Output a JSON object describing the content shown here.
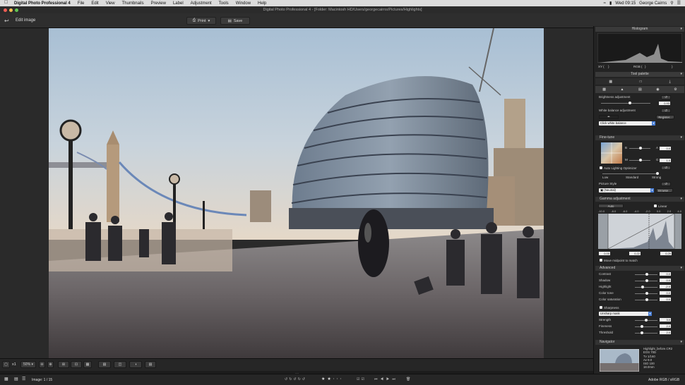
{
  "menubar": {
    "apple": "",
    "app": "Digital Photo Professional 4",
    "items": [
      "File",
      "Edit",
      "View",
      "Thumbnails",
      "Preview",
      "Label",
      "Adjustment",
      "Tools",
      "Window",
      "Help"
    ],
    "clock": "Wed 09:15",
    "user": "George Cairns"
  },
  "window": {
    "title": "Digital Photo Professional 4 - [Folder: Macintosh HD/Users/georgecairns/Pictures/Highlights]"
  },
  "toolbar": {
    "back_label": "Edit image",
    "print_label": "Print",
    "save_label": "Save"
  },
  "viewer": {
    "zoom_x": "x1",
    "zoom_pct": "50%"
  },
  "status": {
    "image_count": "Image: 1 / 15",
    "color_space": "Adobe RGB / sRGB"
  },
  "panel": {
    "histogram": {
      "title": "Histogram",
      "xy": "XY (",
      "rgb": "RGB (",
      "closers": [
        ")",
        ")",
        ")"
      ]
    },
    "tool_palette": {
      "title": "Tool palette"
    },
    "brightness": {
      "label": "Brightness adjustment",
      "value": "0.93",
      "level": 0.55
    },
    "white_balance": {
      "label": "White balance adjustment",
      "register": "Register...",
      "preset": "Click white balance"
    },
    "fine_tune": {
      "label": "Fine-tune",
      "b": "B",
      "a": "A",
      "m": "M",
      "g": "G",
      "a_val": "0.0",
      "g_val": "1.0"
    },
    "alo": {
      "label": "Auto Lighting Optimizer",
      "low": "Low",
      "standard": "Standard",
      "strong": "Strong"
    },
    "picture_style": {
      "label": "Picture Style",
      "value": "(Neutral)",
      "browse": "Browse..."
    },
    "gamma": {
      "title": "Gamma adjustment",
      "auto": "Auto",
      "linear": "Linear",
      "ticks": [
        "-10.0",
        "-8.0",
        "-6.0",
        "-4.0",
        "-2.0",
        "0.0",
        "2.0",
        "4.0"
      ],
      "v1": "0.00",
      "v2": "0.22",
      "v3": "0.29",
      "midpoint": "Move midpoint to match"
    },
    "advanced": {
      "title": "Advanced",
      "rows": [
        {
          "label": "Contrast",
          "value": "0.0",
          "level": 0.5
        },
        {
          "label": "Shadow",
          "value": "0.0",
          "level": 0.5
        },
        {
          "label": "Highlight",
          "value": "-2.0",
          "level": 0.3
        },
        {
          "label": "Color tone",
          "value": "0.0",
          "level": 0.5
        },
        {
          "label": "Color saturation",
          "value": "0.0",
          "level": 0.5
        }
      ],
      "sharpness": "Sharpness",
      "mask": "Unsharp mask",
      "rows2": [
        {
          "label": "Strength",
          "value": "3.0",
          "level": 0.45
        },
        {
          "label": "Fineness",
          "value": "2.0",
          "level": 0.25
        },
        {
          "label": "Threshold",
          "value": "2.0",
          "level": 0.25
        }
      ]
    },
    "navigator": {
      "title": "Navigator",
      "info": [
        "Highlight_before.CR2",
        "EOS 70D",
        "Tv 1/160",
        "Av 9.0",
        "ISO 100",
        "18.0mm"
      ]
    }
  },
  "colors": {
    "accent": "#4a7fd6",
    "panel_bg": "#232323",
    "menubar_bg": "#dcdcdc"
  }
}
